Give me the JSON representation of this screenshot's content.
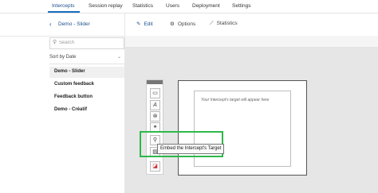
{
  "nav": {
    "tabs": [
      {
        "label": "Intercepts"
      },
      {
        "label": "Session replay"
      },
      {
        "label": "Statistics"
      },
      {
        "label": "Users"
      },
      {
        "label": "Deployment"
      },
      {
        "label": "Settings"
      }
    ],
    "active_tab": "Intercepts"
  },
  "sidebar": {
    "title": "Demo - Slider",
    "back_icon": "chevron-left-icon",
    "search_placeholder": "Search",
    "sort_label": "Sort by Date",
    "items": [
      {
        "label": "Demo - Slider",
        "active": true
      },
      {
        "label": "Custom feedback",
        "active": false
      },
      {
        "label": "Feedback button",
        "active": false
      },
      {
        "label": "Demo - Créatif",
        "active": false
      }
    ]
  },
  "toolbar": {
    "edit_label": "Edit",
    "options_label": "Options",
    "statistics_label": "Statistics"
  },
  "palette": {
    "tools": [
      {
        "icon": "rectangle-icon",
        "glyph": "▭"
      },
      {
        "icon": "text-icon",
        "glyph": "A"
      },
      {
        "icon": "close-circle-icon",
        "glyph": "⊗"
      },
      {
        "icon": "link-icon",
        "glyph": "⚭"
      },
      {
        "icon": "embed-link-icon",
        "glyph": "⚲"
      },
      {
        "icon": "image-icon",
        "glyph": "▨"
      },
      {
        "icon": "color-swatch-icon",
        "glyph": "◪"
      }
    ]
  },
  "preview": {
    "placeholder_text": "Your Intercept's target will appear here"
  },
  "tooltip": {
    "text": "Embed the Intercept's Target"
  },
  "colors": {
    "accent": "#1a4f8c",
    "highlight": "#2db84a",
    "canvas": "#e6e6e6"
  }
}
